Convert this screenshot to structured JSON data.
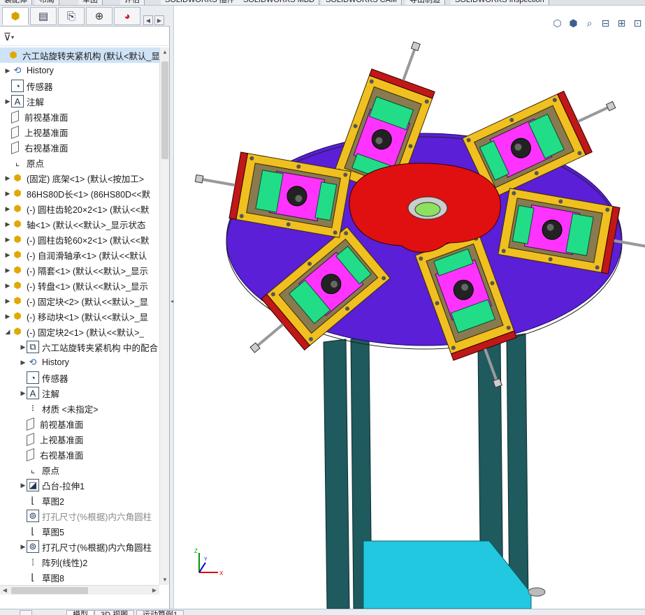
{
  "top_tabs": [
    "装配体",
    "布局",
    "草图",
    "评估",
    "SOLIDWORKS 插件",
    "SOLIDWORKS MBD",
    "SOLIDWORKS CAM",
    "导出制造",
    "SOLIDWORKS Inspection"
  ],
  "tree": {
    "root": "六工站旋转夹紧机构  (默认<默认_显示",
    "items": [
      {
        "label": "History",
        "icon": "history-icon"
      },
      {
        "label": "传感器",
        "icon": "sensor-icon"
      },
      {
        "label": "注解",
        "icon": "annotation-icon"
      },
      {
        "label": "前视基准面",
        "icon": "plane-icon"
      },
      {
        "label": "上视基准面",
        "icon": "plane-icon"
      },
      {
        "label": "右视基准面",
        "icon": "plane-icon"
      },
      {
        "label": "原点",
        "icon": "origin-icon"
      },
      {
        "label": "(固定) 底架<1> (默认<按加工>",
        "icon": "part-icon"
      },
      {
        "label": "86HS80D长<1> (86HS80D<<默",
        "icon": "part-icon"
      },
      {
        "label": "(-) 圆柱齿轮20×2<1> (默认<<默",
        "icon": "part-icon"
      },
      {
        "label": "轴<1> (默认<<默认>_显示状态",
        "icon": "part-icon"
      },
      {
        "label": "(-) 圆柱齿轮60×2<1> (默认<<默",
        "icon": "part-icon"
      },
      {
        "label": "(-) 自润滑轴承<1> (默认<<默认",
        "icon": "part-icon"
      },
      {
        "label": "(-) 隔套<1> (默认<<默认>_显示",
        "icon": "part-icon"
      },
      {
        "label": "(-) 转盘<1> (默认<<默认>_显示",
        "icon": "part-icon"
      },
      {
        "label": "(-) 固定块<2> (默认<<默认>_显",
        "icon": "part-icon"
      },
      {
        "label": "(-) 移动块<1> (默认<<默认>_显",
        "icon": "part-icon"
      },
      {
        "label": "(-) 固定块2<1> (默认<<默认>_",
        "icon": "part-icon"
      },
      {
        "label": "六工站旋转夹紧机构 中的配合",
        "icon": "mates-icon"
      },
      {
        "label": "History",
        "icon": "history-icon"
      },
      {
        "label": "传感器",
        "icon": "sensor-icon"
      },
      {
        "label": "注解",
        "icon": "annotation-icon"
      },
      {
        "label": "材质 <未指定>",
        "icon": "material-icon"
      },
      {
        "label": "前视基准面",
        "icon": "plane-icon"
      },
      {
        "label": "上视基准面",
        "icon": "plane-icon"
      },
      {
        "label": "右视基准面",
        "icon": "plane-icon"
      },
      {
        "label": "原点",
        "icon": "origin-icon"
      },
      {
        "label": "凸台-拉伸1",
        "icon": "extrude-icon"
      },
      {
        "label": "草图2",
        "icon": "sketch-icon"
      },
      {
        "label": "打孔尺寸(%根据)内六角圆柱",
        "icon": "hole-icon"
      },
      {
        "label": "草图5",
        "icon": "sketch-icon"
      },
      {
        "label": "打孔尺寸(%根据)内六角圆柱",
        "icon": "hole-icon"
      },
      {
        "label": "阵列(线性)2",
        "icon": "pattern-icon"
      },
      {
        "label": "草图8",
        "icon": "sketch-icon"
      }
    ]
  },
  "bottom_tabs": [
    "",
    "模型",
    "3D 视图",
    "运动算例1"
  ],
  "triad": {
    "x": "X",
    "y": "Y",
    "z": "Z"
  },
  "colors": {
    "turntable": "#5a1fd6",
    "center_disc": "#e01010",
    "bracket": "#f0c020",
    "block": "#22dd88",
    "magenta": "#ff33ff",
    "leg": "#1e5a5e",
    "base_plate": "#22c8e0"
  }
}
